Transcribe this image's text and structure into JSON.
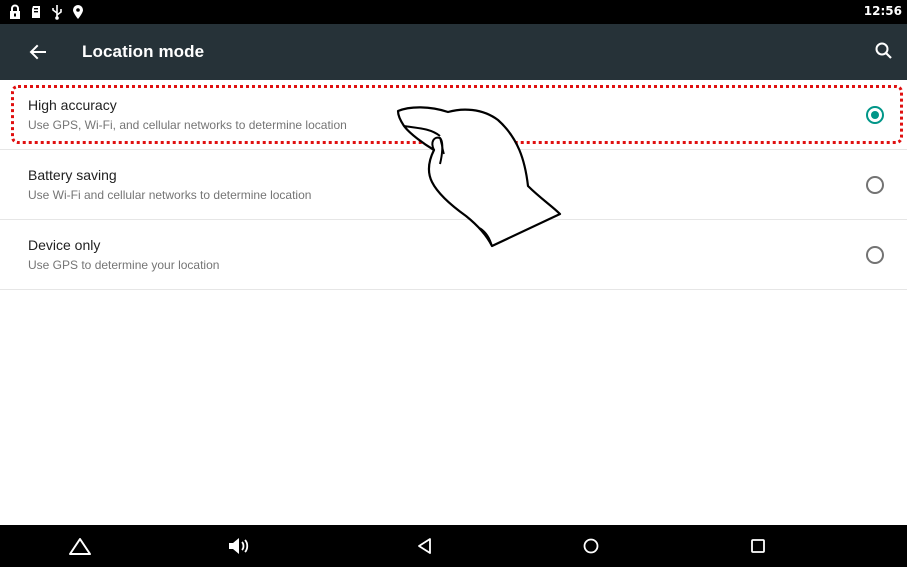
{
  "status_bar": {
    "time": "12:56",
    "icons": [
      "lock-icon",
      "sd-card-icon",
      "usb-icon",
      "location-pin-icon"
    ]
  },
  "app_bar": {
    "title": "Location mode",
    "back_icon": "arrow-back-icon",
    "search_icon": "search-icon"
  },
  "options": [
    {
      "title": "High accuracy",
      "subtitle": "Use GPS, Wi-Fi, and cellular networks to determine location",
      "selected": true
    },
    {
      "title": "Battery saving",
      "subtitle": "Use Wi-Fi and cellular networks to determine location",
      "selected": false
    },
    {
      "title": "Device only",
      "subtitle": "Use GPS to determine your location",
      "selected": false
    }
  ],
  "colors": {
    "app_bar": "#263238",
    "accent": "#009688",
    "highlight": "#e01010"
  },
  "nav_bar": {
    "icons": [
      "home-outline-icon",
      "volume-icon",
      "back-triangle-icon",
      "circle-home-icon",
      "square-recents-icon"
    ]
  }
}
